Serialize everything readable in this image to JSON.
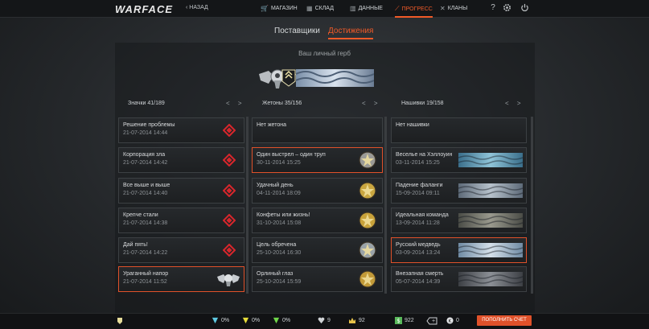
{
  "app": {
    "logo": "WARFACE",
    "back_label": "НАЗАД"
  },
  "nav": [
    {
      "label": "МАГАЗИН",
      "icon": "cart-icon",
      "active": false
    },
    {
      "label": "СКЛАД",
      "icon": "warehouse-icon",
      "active": false
    },
    {
      "label": "ДАННЫЕ",
      "icon": "stats-icon",
      "active": false
    },
    {
      "label": "ПРОГРЕСС",
      "icon": "progress-icon",
      "active": true
    },
    {
      "label": "КЛАНЫ",
      "icon": "clans-icon",
      "active": false
    }
  ],
  "top_icons": {
    "help": "?",
    "settings": "gear-icon",
    "power": "power-icon"
  },
  "tabs": [
    {
      "label": "Поставщики",
      "active": false
    },
    {
      "label": "Достижения",
      "active": true
    }
  ],
  "emblem": {
    "label": "Ваш личный герб"
  },
  "columns": {
    "badges": {
      "title": "Значки 41/189",
      "items": [
        {
          "title": "Решение проблемы",
          "date": "21-07-2014 14:44",
          "selected": false
        },
        {
          "title": "Корпорация зла",
          "date": "21-07-2014 14:42",
          "selected": false
        },
        {
          "title": "Все выше и выше",
          "date": "21-07-2014 14:40",
          "selected": false
        },
        {
          "title": "Крепче стали",
          "date": "21-07-2014 14:38",
          "selected": false
        },
        {
          "title": "Дай пять!",
          "date": "21-07-2014 14:22",
          "selected": false
        },
        {
          "title": "Ураганный напор",
          "date": "21-07-2014 11:52",
          "selected": true
        }
      ]
    },
    "tokens": {
      "title": "Жетоны 35/156",
      "items": [
        {
          "title": "Нет жетона",
          "date": "",
          "selected": false
        },
        {
          "title": "Один выстрел – один труп",
          "date": "30-11-2014 15:25",
          "selected": true
        },
        {
          "title": "Удачный день",
          "date": "04-11-2014 18:09",
          "selected": false
        },
        {
          "title": "Конфеты или жизнь!",
          "date": "31-10-2014 15:08",
          "selected": false
        },
        {
          "title": "Цель обречена",
          "date": "25-10-2014 16:30",
          "selected": false
        },
        {
          "title": "Орлиный глаз",
          "date": "25-10-2014 15:59",
          "selected": false
        }
      ]
    },
    "stripes": {
      "title": "Нашивки 19/158",
      "items": [
        {
          "title": "Нет нашивки",
          "date": "",
          "selected": false
        },
        {
          "title": "Веселье на Хэллоуин",
          "date": "03-11-2014 15:25",
          "selected": false
        },
        {
          "title": "Падение фаланги",
          "date": "15-09-2014 09:11",
          "selected": false
        },
        {
          "title": "Идеальная команда",
          "date": "13-09-2014 11:28",
          "selected": false
        },
        {
          "title": "Русский медведь",
          "date": "03-09-2014 13:24",
          "selected": true
        },
        {
          "title": "Внезапная смерть",
          "date": "05-07-2014 14:39",
          "selected": false
        }
      ]
    }
  },
  "status": {
    "stat1": "0%",
    "stat2": "0%",
    "stat3": "0%",
    "stat4": "9",
    "stat5": "92",
    "money": "922",
    "plus": "+",
    "k": "0",
    "topup_label": "ПОПОЛНИТЬ СЧЕТ"
  },
  "colors": {
    "accent": "#f05a28",
    "selected_border": "#e0512a",
    "badge_red": "#d8262c"
  }
}
